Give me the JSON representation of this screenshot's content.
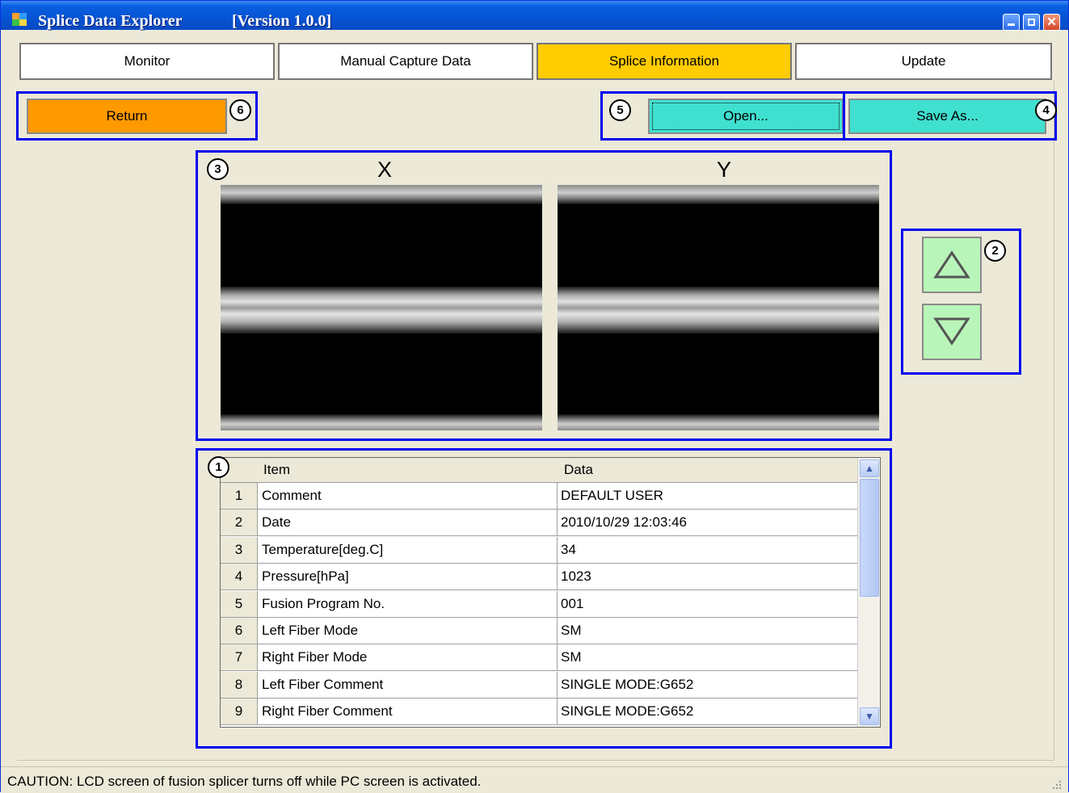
{
  "window": {
    "title": "Splice Data Explorer",
    "version": "[Version 1.0.0]"
  },
  "tabs": [
    {
      "label": "Monitor"
    },
    {
      "label": "Manual Capture Data"
    },
    {
      "label": "Splice Information"
    },
    {
      "label": "Update"
    }
  ],
  "toolbar": {
    "return_label": "Return",
    "open_label": "Open...",
    "save_as_label": "Save As..."
  },
  "markers": {
    "table": "1",
    "arrows": "2",
    "images": "3",
    "save_as": "4",
    "open": "5",
    "return": "6"
  },
  "images": {
    "x_label": "X",
    "y_label": "Y"
  },
  "table": {
    "headers": {
      "item": "Item",
      "data": "Data"
    },
    "rows": [
      {
        "n": "1",
        "item": "Comment",
        "data": "DEFAULT USER"
      },
      {
        "n": "2",
        "item": "Date",
        "data": "2010/10/29  12:03:46"
      },
      {
        "n": "3",
        "item": "Temperature[deg.C]",
        "data": "34"
      },
      {
        "n": "4",
        "item": "Pressure[hPa]",
        "data": "1023"
      },
      {
        "n": "5",
        "item": "Fusion Program No.",
        "data": "001"
      },
      {
        "n": "6",
        "item": "Left Fiber Mode",
        "data": "SM"
      },
      {
        "n": "7",
        "item": "Right Fiber Mode",
        "data": "SM"
      },
      {
        "n": "8",
        "item": "Left Fiber Comment",
        "data": "SINGLE MODE:G652"
      },
      {
        "n": "9",
        "item": "Right Fiber Comment",
        "data": "SINGLE MODE:G652"
      }
    ]
  },
  "status": {
    "text": "CAUTION: LCD screen of fusion splicer turns off while PC screen is activated."
  },
  "colors": {
    "active_tab": "#ffcc00",
    "return_button": "#ff9900",
    "teal_buttons": "#40e0d0",
    "arrow_buttons": "#b9f5b9",
    "annotation_frame": "#0000ee"
  }
}
